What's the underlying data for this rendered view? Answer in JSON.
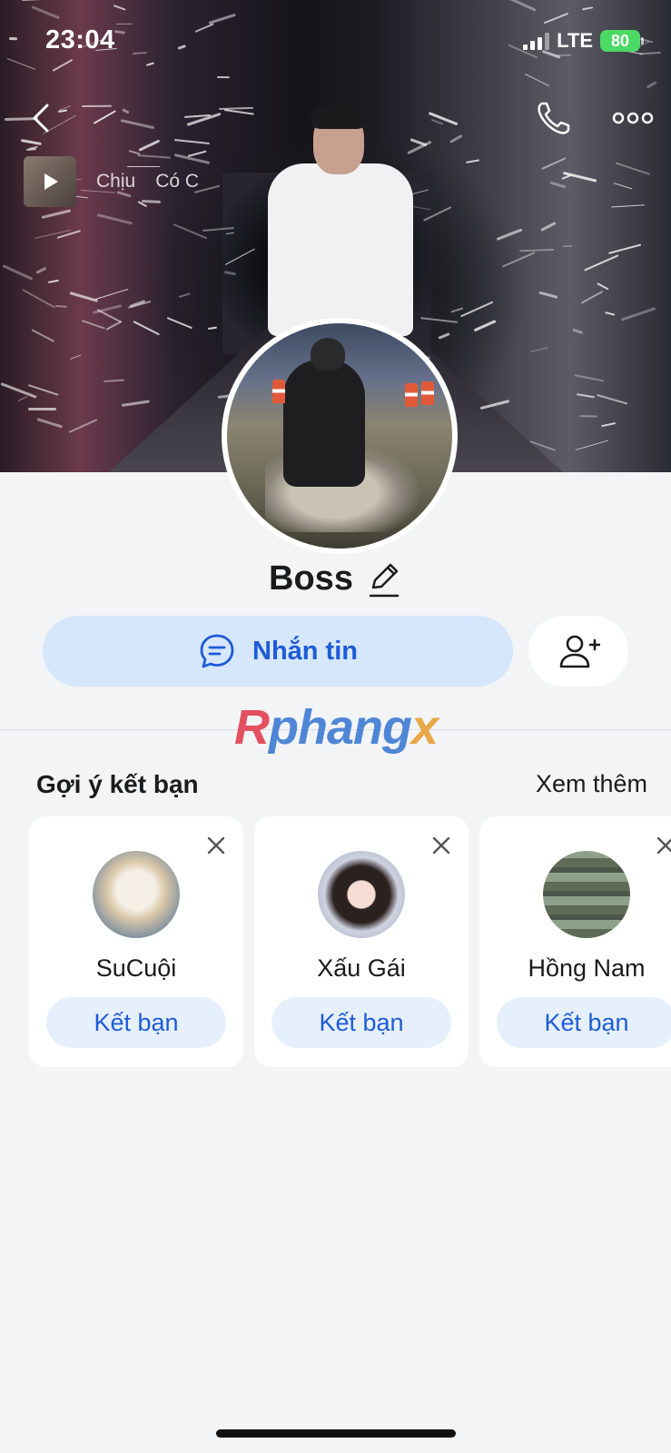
{
  "status_bar": {
    "time": "23:04",
    "network": "LTE",
    "battery": "80"
  },
  "cover_music": {
    "lyric_1": "Chịu",
    "lyric_2": "Có C"
  },
  "profile": {
    "name": "Boss"
  },
  "actions": {
    "message_label": "Nhắn tin"
  },
  "watermark": {
    "part1": "R",
    "part2": "phang",
    "part3": "x"
  },
  "suggestions": {
    "title": "Gợi ý kết bạn",
    "see_more": "Xem thêm",
    "items": [
      {
        "name": "SuCuội",
        "button": "Kết bạn"
      },
      {
        "name": "Xấu Gái",
        "button": "Kết bạn"
      },
      {
        "name": "Hồng Nam",
        "button": "Kết bạn"
      }
    ]
  },
  "colors": {
    "accent": "#1e5bd7",
    "button_bg": "#d6e6fb",
    "page_bg": "#f3f4f6"
  }
}
